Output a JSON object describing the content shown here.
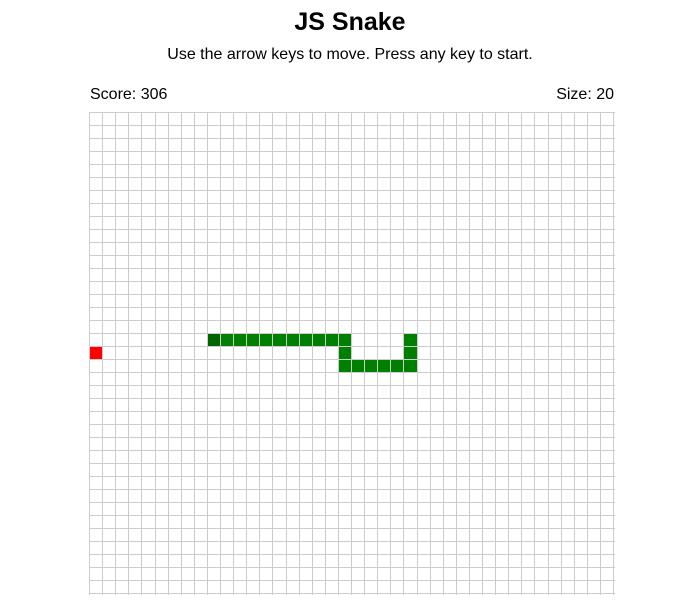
{
  "game": {
    "title": "JS Snake",
    "instructions": "Use the arrow keys to move. Press any key to start.",
    "score_text": "Score: 306",
    "size_text": "Size: 20"
  },
  "board": {
    "columns": 40,
    "rows": 37,
    "colors": {
      "background": "#ffffff",
      "grid_line": "#cccccc",
      "snake_body": "#008000",
      "snake_head": "#006400",
      "food": "#ff0000"
    },
    "snake_cells": [
      [
        9,
        17
      ],
      [
        10,
        17
      ],
      [
        11,
        17
      ],
      [
        12,
        17
      ],
      [
        13,
        17
      ],
      [
        14,
        17
      ],
      [
        15,
        17
      ],
      [
        16,
        17
      ],
      [
        17,
        17
      ],
      [
        18,
        17
      ],
      [
        19,
        17
      ],
      [
        19,
        18
      ],
      [
        19,
        19
      ],
      [
        20,
        19
      ],
      [
        21,
        19
      ],
      [
        22,
        19
      ],
      [
        23,
        19
      ],
      [
        24,
        19
      ],
      [
        24,
        18
      ],
      [
        24,
        17
      ]
    ],
    "head_cell": [
      9,
      17
    ],
    "food_cell": [
      0,
      18
    ]
  }
}
